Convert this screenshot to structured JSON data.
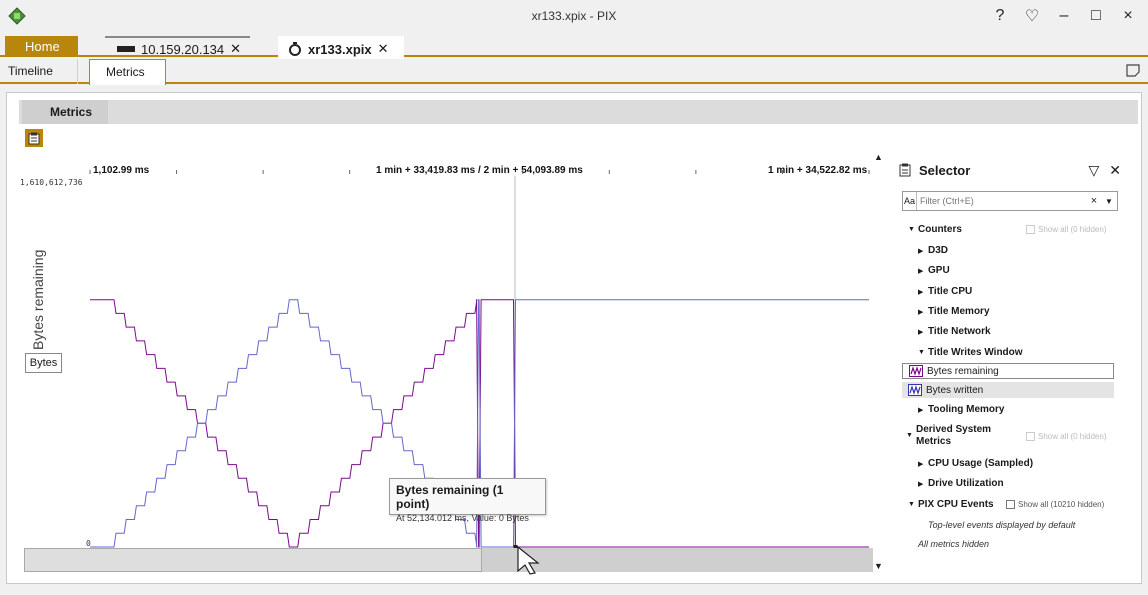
{
  "window": {
    "title": "xr133.xpix - PIX",
    "controls": [
      "?",
      "♡",
      "–",
      "□",
      "×"
    ]
  },
  "doc_tabs": {
    "home": "Home",
    "remote": "10.159.20.134",
    "active": "xr133.xpix"
  },
  "view_tabs": {
    "timeline": "Timeline",
    "metrics": "Metrics"
  },
  "metrics_panel": {
    "tab_label": "Metrics",
    "time_left": "1,102.99 ms",
    "time_center": "1 min + 33,419.83 ms / 2 min + 54,093.89 ms",
    "time_right": "1 min + 34,522.82 ms",
    "y_max": "1,610,612,736",
    "y_min": "0",
    "y_label": "Bytes remaining",
    "units_button": "Bytes"
  },
  "tooltip": {
    "title": "Bytes remaining (1 point)",
    "detail": "At 52,134.012 ms, Value: 0 Bytes"
  },
  "selector": {
    "title": "Selector",
    "filter_placeholder": "Filter (Ctrl+E)",
    "aa": "Aa",
    "counters": "Counters",
    "show_all_counters": "Show all (0 hidden)",
    "d3d": "D3D",
    "gpu": "GPU",
    "title_cpu": "Title CPU",
    "title_memory": "Title Memory",
    "title_network": "Title Network",
    "title_writes_window": "Title Writes Window",
    "bytes_remaining": "Bytes remaining",
    "bytes_written": "Bytes written",
    "tooling_memory": "Tooling Memory",
    "derived_system_metrics": "Derived System Metrics",
    "show_all_derived": "Show all (0 hidden)",
    "cpu_usage": "CPU Usage (Sampled)",
    "drive_utilization": "Drive Utilization",
    "pix_cpu_events": "PIX CPU Events",
    "show_all_pix": "Show all (10210 hidden)",
    "note_top_level": "Top-level events displayed by default",
    "note_hidden": "All metrics hidden"
  },
  "colors": {
    "accent": "#b8860b",
    "bytes_remaining": "#7a0a8c",
    "bytes_written": "#6666cc"
  },
  "chart_data": {
    "type": "line",
    "ylim": [
      0,
      1610612736
    ],
    "series": [
      {
        "name": "Bytes remaining",
        "color": "#7a0a8c",
        "x_ms": [
          1103,
          3000,
          25000,
          47500,
          47700,
          48000,
          52134,
          94523
        ],
        "values": [
          1073741824,
          1073741824,
          0,
          1073741824,
          0,
          1073741824,
          0,
          0
        ]
      },
      {
        "name": "Bytes written",
        "color": "#6666cc",
        "x_ms": [
          1103,
          3000,
          25000,
          47500,
          47700,
          48000,
          52134,
          94523
        ],
        "values": [
          0,
          0,
          1073741824,
          0,
          1073741824,
          0,
          1073741824,
          1073741824
        ]
      }
    ]
  }
}
